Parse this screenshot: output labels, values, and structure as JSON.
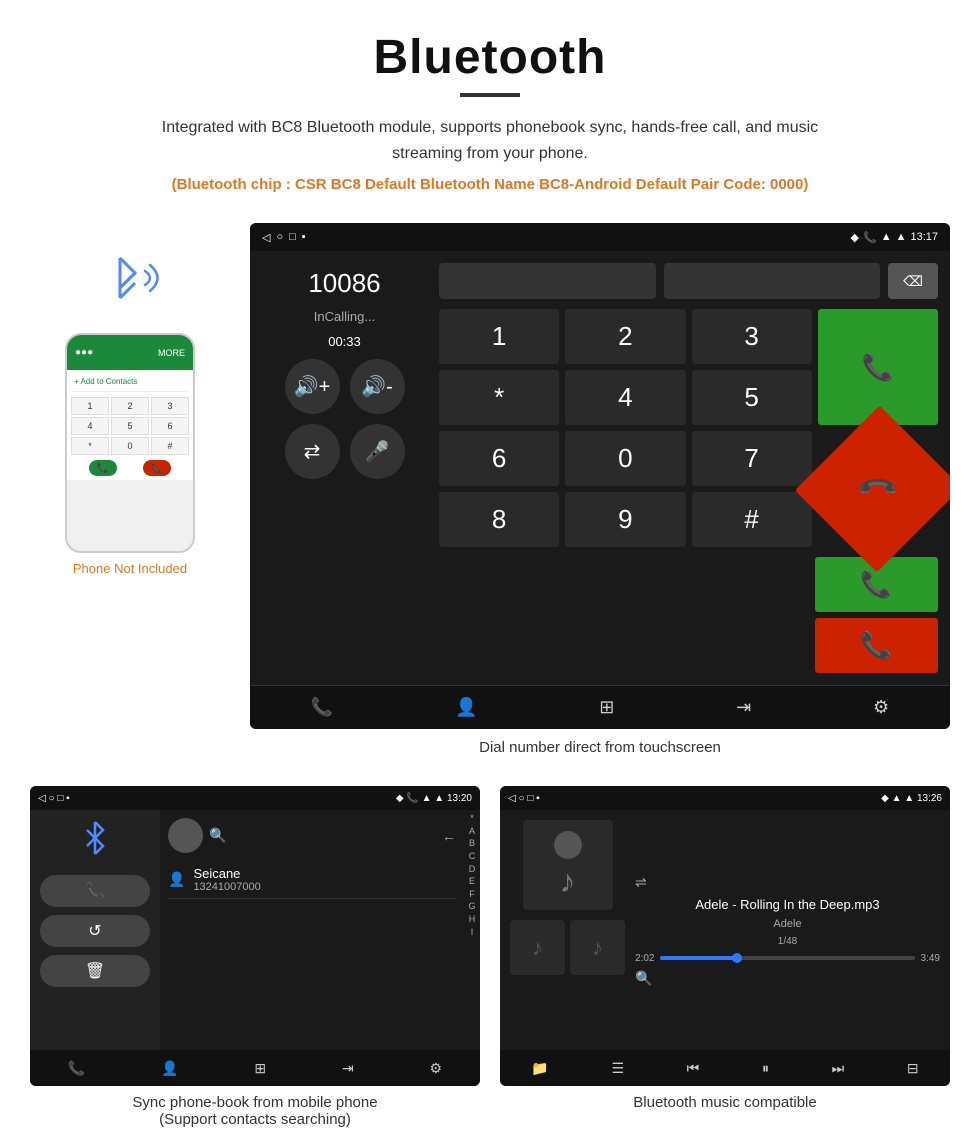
{
  "header": {
    "title": "Bluetooth",
    "description": "Integrated with BC8 Bluetooth module, supports phonebook sync, hands-free call, and music streaming from your phone.",
    "specs": "(Bluetooth chip : CSR BC8    Default Bluetooth Name BC8-Android    Default Pair Code: 0000)"
  },
  "dial_screen": {
    "status_bar": {
      "left_icons": [
        "back",
        "home",
        "recents",
        "dot"
      ],
      "right_icons": [
        "location",
        "phone",
        "signal",
        "wifi"
      ],
      "time": "13:17"
    },
    "number": "10086",
    "call_status": "InCalling...",
    "timer": "00:33",
    "numpad": [
      "1",
      "2",
      "3",
      "*",
      "4",
      "5",
      "6",
      "0",
      "7",
      "8",
      "9",
      "#"
    ],
    "call_button": "call",
    "end_button": "end"
  },
  "dial_caption": "Dial number direct from touchscreen",
  "phonebook_screen": {
    "status_bar": {
      "time": "13:20"
    },
    "contact_name": "Seicane",
    "contact_number": "13241007000",
    "alphabet": [
      "*",
      "A",
      "B",
      "C",
      "D",
      "E",
      "F",
      "G",
      "H",
      "I"
    ]
  },
  "phonebook_caption_line1": "Sync phone-book from mobile phone",
  "phonebook_caption_line2": "(Support contacts searching)",
  "music_screen": {
    "status_bar": {
      "time": "13:26"
    },
    "song_title": "Adele - Rolling In the Deep.mp3",
    "artist": "Adele",
    "track_info": "1/48",
    "time_current": "2:02",
    "time_total": "3:49",
    "progress_percent": 30
  },
  "music_caption": "Bluetooth music compatible",
  "phone_not_included": "Phone Not Included",
  "colors": {
    "orange": "#e07820",
    "green_btn": "#2a9a2a",
    "red_btn": "#cc2200",
    "blue_progress": "#2a7aff",
    "blue_bt": "#5588ff"
  }
}
